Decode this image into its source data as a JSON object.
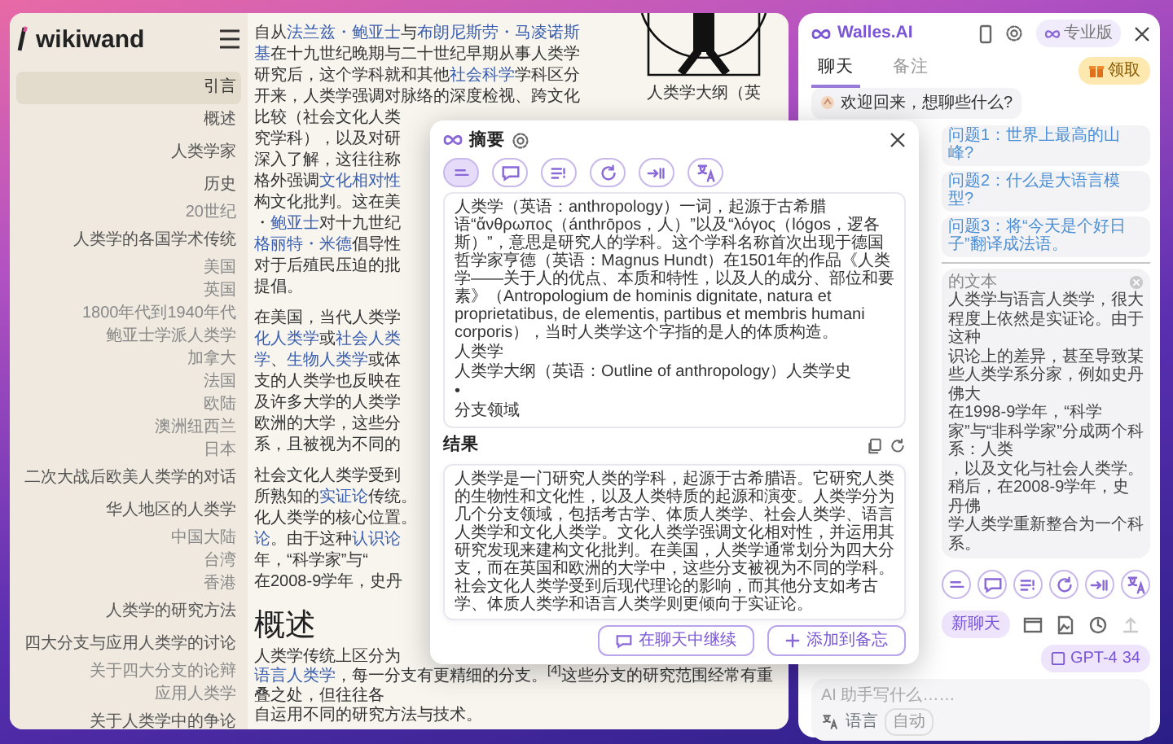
{
  "wiki": {
    "logo": "wikiwand",
    "toc": [
      {
        "label": "引言",
        "selected": true
      },
      {
        "label": "概述",
        "selected": false
      },
      {
        "label": "人类学家",
        "selected": false
      },
      {
        "label": "历史",
        "selected": false,
        "children": [
          {
            "label": "20世纪",
            "selected": false
          }
        ]
      },
      {
        "label": "人类学的各国学术传统",
        "selected": false,
        "children": [
          {
            "label": "美国",
            "selected": false
          },
          {
            "label": "英国",
            "selected": false
          },
          {
            "label": "1800年代到1940年代",
            "selected": false
          },
          {
            "label": "鲍亚士学派人类学",
            "selected": false
          },
          {
            "label": "加拿大",
            "selected": false
          },
          {
            "label": "法国",
            "selected": false
          },
          {
            "label": "欧陆",
            "selected": false
          },
          {
            "label": "澳洲纽西兰",
            "selected": false
          },
          {
            "label": "日本",
            "selected": false
          }
        ]
      },
      {
        "label": "二次大战后欧美人类学的对话",
        "selected": false
      },
      {
        "label": "华人地区的人类学",
        "selected": false,
        "children": [
          {
            "label": "中国大陆",
            "selected": false
          },
          {
            "label": "台湾",
            "selected": false
          },
          {
            "label": "香港",
            "selected": false
          }
        ]
      },
      {
        "label": "人类学的研究方法",
        "selected": false
      },
      {
        "label": "四大分支与应用人类学的讨论",
        "selected": false,
        "children": [
          {
            "label": "关于四大分支的论辩",
            "selected": false
          },
          {
            "label": "应用人类学",
            "selected": false
          }
        ]
      },
      {
        "label": "关于人类学中的争论",
        "selected": false
      }
    ]
  },
  "article": {
    "figure_caption": "人类学大纲（英",
    "blocks": [
      {
        "kind": "paragraph",
        "lines": [
          [
            {
              "text": "自从",
              "link": false
            },
            {
              "text": "法兰兹・鲍亚士",
              "link": true
            },
            {
              "text": "与",
              "link": false
            },
            {
              "text": "布朗尼斯劳・马凌诺斯",
              "link": true
            }
          ],
          [
            {
              "text": "基",
              "link": true
            },
            {
              "text": "在十九世纪晚期与二十世纪早期从事人类学",
              "link": false
            }
          ],
          [
            {
              "text": "研究后，这个学科就和其他",
              "link": false
            },
            {
              "text": "社会科学",
              "link": true
            },
            {
              "text": "学科区分",
              "link": false
            }
          ],
          [
            {
              "text": "开来，人类学强调对脉络的深度检视、跨文化",
              "link": false
            }
          ],
          [
            {
              "text": "比较（社会文化人类",
              "link": false
            }
          ],
          [
            {
              "text": "究学科），以及对研",
              "link": false
            }
          ],
          [
            {
              "text": "深入了解，这往往称",
              "link": false
            }
          ],
          [
            {
              "text": "格外强调",
              "link": false
            },
            {
              "text": "文化相对性",
              "link": true
            }
          ],
          [
            {
              "text": "构文化批判。这在美",
              "link": false
            }
          ],
          [
            {
              "text": "・",
              "link": false
            },
            {
              "text": "鲍亚士",
              "link": true
            },
            {
              "text": "对十九世纪",
              "link": false
            }
          ],
          [
            {
              "text": "格丽特・米德",
              "link": true
            },
            {
              "text": "倡导性",
              "link": false
            }
          ],
          [
            {
              "text": "对于后殖民压迫的批",
              "link": false
            }
          ],
          [
            {
              "text": "提倡。",
              "link": false
            }
          ]
        ]
      },
      {
        "kind": "paragraph",
        "lines": [
          [
            {
              "text": "在美国，当代人类学",
              "link": false
            }
          ],
          [
            {
              "text": "化人类学",
              "link": true
            },
            {
              "text": "或",
              "link": false
            },
            {
              "text": "社会人类",
              "link": true
            }
          ],
          [
            {
              "text": "学",
              "link": true
            },
            {
              "text": "、",
              "link": false
            },
            {
              "text": "生物人类学",
              "link": true
            },
            {
              "text": "或体",
              "link": false
            }
          ],
          [
            {
              "text": "支的人类学也反映在",
              "link": false
            }
          ],
          [
            {
              "text": "及许多大学的人类学",
              "link": false
            }
          ],
          [
            {
              "text": "欧洲的大学，这些分",
              "link": false
            }
          ],
          [
            {
              "text": "系，且被视为不同的",
              "link": false
            }
          ]
        ]
      },
      {
        "kind": "paragraph",
        "lines": [
          [
            {
              "text": "社会文化人类学受到",
              "link": false
            }
          ],
          [
            {
              "text": "所熟知的",
              "link": false
            },
            {
              "text": "实证论",
              "link": true
            },
            {
              "text": "传统。",
              "link": false
            }
          ],
          [
            {
              "text": "化人类学的核心位置。",
              "link": false
            }
          ],
          [
            {
              "text": "论",
              "link": true
            },
            {
              "text": "。由于这种",
              "link": false
            },
            {
              "text": "认识论",
              "link": true
            }
          ],
          [
            {
              "text": "年，“科学家”与“",
              "link": false
            }
          ],
          [
            {
              "text": "在2008-9学年，史丹",
              "link": false
            }
          ]
        ]
      },
      {
        "kind": "heading",
        "text": "概述"
      },
      {
        "kind": "paragraph",
        "lines": [
          [
            {
              "text": "人类学传统上区分为",
              "link": false
            }
          ],
          [
            {
              "text": "语言人类学",
              "link": true
            },
            {
              "text": "，每一分支有更精细的分支。$^{[4]}$这些分支的研究范围经常有重叠之处，但往往各",
              "link": false
            }
          ],
          [
            {
              "text": "自运用不同的研究方法与技术。",
              "link": false
            }
          ]
        ]
      }
    ]
  },
  "popup": {
    "title": "摘要",
    "tools": [
      {
        "selected": true
      },
      {
        "selected": false
      },
      {
        "selected": false
      },
      {
        "selected": false
      },
      {
        "selected": false
      },
      {
        "selected": false
      }
    ],
    "source": [
      "人类学（英语：anthropology）一词，起源于古希腊语“ἄνθρωπος（ánthrōpos，人）”以及“λόγος（lógos，逻各斯）”，意思是研究人的学科。这个学科名称首次出现于德国哲学家亨德（英语：Magnus Hundt）在1501年的作品《人类学——关于人的优点、本质和特性，以及人的成分、部位和要素》（Antropologium de hominis dignitate, natura et proprietatibus, de elementis, partibus et membris humani corporis），当时人类学这个字指的是人的体质构造。",
      "人类学",
      "人类学大纲（英语：Outline of anthropology）人类学史",
      "•",
      "分支领域"
    ],
    "result_label": "结果",
    "result": "人类学是一门研究人类的学科，起源于古希腊语。它研究人类的生物性和文化性，以及人类特质的起源和演变。人类学分为几个分支领域，包括考古学、体质人类学、社会人类学、语言人类学和文化人类学。文化人类学强调文化相对性，并运用其研究发现来建构文化批判。在美国，人类学通常划分为四大分支，而在英国和欧洲的大学中，这些分支被视为不同的学科。社会文化人类学受到后现代理论的影响，而其他分支如考古学、体质人类学和语言人类学则更倾向于实证论。",
    "buttons": [
      "在聊天中继续",
      "添加到备忘"
    ]
  },
  "assistant": {
    "brand": "Walles.AI",
    "plan": "专业版",
    "tabs": [
      {
        "label": "聊天",
        "selected": true
      },
      {
        "label": "备注",
        "selected": false
      }
    ],
    "gift": "领取",
    "greeting": "欢迎回来，想聊些什么?",
    "suggestions": [
      "问题1：世界上最高的山峰?",
      "问题2：什么是大语言模型?",
      "问题3：将“今天是个好日子”翻译成法语。"
    ],
    "selection": {
      "label": "的文本",
      "lines": [
        "人类学与语言人类学，很大程度上依然是实证论。由于这种",
        "识论上的差异，甚至导致某些人类学系分家，例如史丹佛大",
        "在1998-9学年，“科学家”与“非科学家”分成两个科系：人类",
        "，以及文化与社会人类学。稍后，在2008-9学年，史丹佛",
        "学人类学重新整合为一个科系。"
      ]
    },
    "tools": [
      {
        "selected": false
      },
      {
        "selected": false
      },
      {
        "selected": false
      },
      {
        "selected": false
      },
      {
        "selected": false
      },
      {
        "selected": false
      }
    ],
    "new_chat": "新聊天",
    "actions": [
      {
        "disabled": false
      },
      {
        "disabled": false
      },
      {
        "disabled": false
      },
      {
        "disabled": true
      }
    ],
    "model": "GPT-4",
    "model_count": "34",
    "placeholder": "AI 助手写什么……",
    "language_label": "语言",
    "language_value": "自动"
  }
}
